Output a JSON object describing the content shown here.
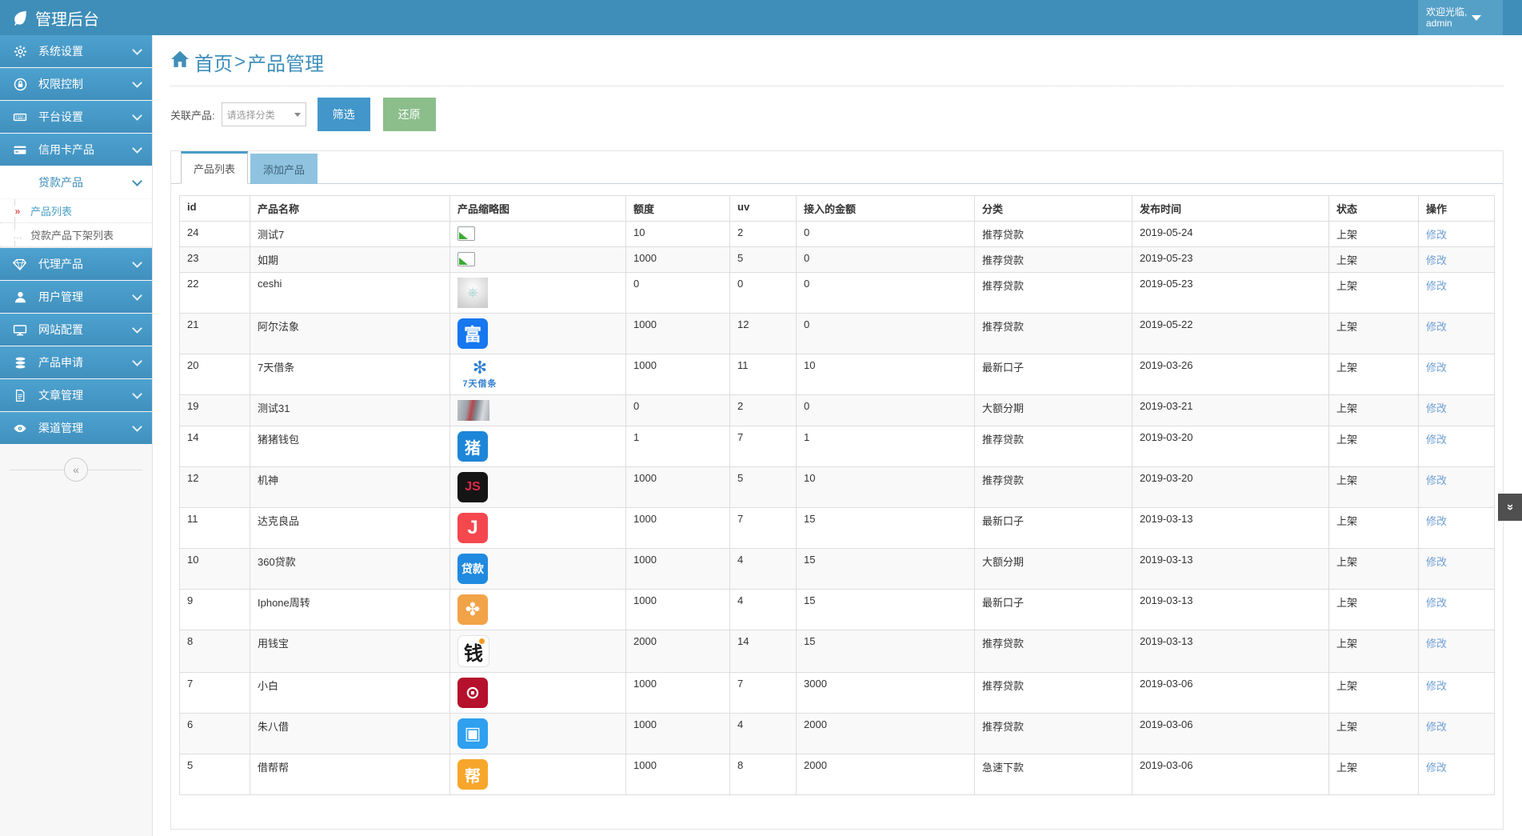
{
  "colors": {
    "accent": "#3e8eb9",
    "sidebar_item": "#4697c4",
    "filter_button": "#4296ca",
    "reset_button": "#8cbe8c",
    "link": "#6f9ed4",
    "inactive_tab": "#8fc3e0"
  },
  "header": {
    "title": "管理后台",
    "logo_icon": "leaf-icon",
    "welcome_line1": "欢迎光临,",
    "welcome_line2": "admin"
  },
  "sidebar": {
    "collapse_label": "«",
    "items": [
      {
        "label": "系统设置",
        "icon": "gear-icon"
      },
      {
        "label": "权限控制",
        "icon": "lock-icon"
      },
      {
        "label": "平台设置",
        "icon": "keyboard-icon"
      },
      {
        "label": "信用卡产品",
        "icon": "credit-card-icon"
      },
      {
        "label": "贷款产品",
        "icon": "loan-coin-icon",
        "expanded": true,
        "children": [
          {
            "label": "产品列表",
            "active": true,
            "marker": "»"
          },
          {
            "label": "贷款产品下架列表",
            "active": false,
            "marker": "…"
          }
        ]
      },
      {
        "label": "代理产品",
        "icon": "diamond-icon"
      },
      {
        "label": "用户管理",
        "icon": "user-icon"
      },
      {
        "label": "网站配置",
        "icon": "monitor-icon"
      },
      {
        "label": "产品申请",
        "icon": "database-icon"
      },
      {
        "label": "文章管理",
        "icon": "document-icon"
      },
      {
        "label": "渠道管理",
        "icon": "eye-icon"
      }
    ]
  },
  "breadcrumb": {
    "home": "首页",
    "separator": ">",
    "current": "产品管理"
  },
  "filter": {
    "label": "关联产品:",
    "select_value": "请选择分类",
    "filter_button": "筛选",
    "reset_button": "还原"
  },
  "tabs": [
    {
      "label": "产品列表",
      "active": true
    },
    {
      "label": "添加产品",
      "active": false
    }
  ],
  "table": {
    "columns": [
      "id",
      "产品名称",
      "产品缩略图",
      "额度",
      "uv",
      "接入的金额",
      "分类",
      "发布时间",
      "状态",
      "操作"
    ],
    "rows": [
      {
        "id": "24",
        "name": "测试7",
        "thumb": {
          "type": "broken",
          "name": "broken-image-icon"
        },
        "quota": "10",
        "uv": "2",
        "amount": "0",
        "category": "推荐贷款",
        "date": "2019-05-24",
        "status": "上架",
        "action": "修改"
      },
      {
        "id": "23",
        "name": "如期",
        "thumb": {
          "type": "broken",
          "name": "broken-image-icon"
        },
        "quota": "1000",
        "uv": "5",
        "amount": "0",
        "category": "推荐贷款",
        "date": "2019-05-23",
        "status": "上架",
        "action": "修改"
      },
      {
        "id": "22",
        "name": "ceshi",
        "thumb": {
          "type": "gray",
          "name": "ceshi-helm-thumbnail",
          "glyph": "⎈"
        },
        "quota": "0",
        "uv": "0",
        "amount": "0",
        "category": "推荐贷款",
        "date": "2019-05-23",
        "status": "上架",
        "action": "修改"
      },
      {
        "id": "21",
        "name": "阿尔法象",
        "thumb": {
          "type": "icon",
          "name": "alpha-elephant-app-icon",
          "bg": "#1677f0",
          "fg": "#ffffff",
          "glyph": "富",
          "size": 22
        },
        "quota": "1000",
        "uv": "12",
        "amount": "0",
        "category": "推荐贷款",
        "date": "2019-05-22",
        "status": "上架",
        "action": "修改"
      },
      {
        "id": "20",
        "name": "7天借条",
        "thumb": {
          "type": "logo",
          "name": "7tian-jietiao-logo",
          "glyph": "✻",
          "label": "7天借条"
        },
        "quota": "1000",
        "uv": "11",
        "amount": "10",
        "category": "最新口子",
        "date": "2019-03-26",
        "status": "上架",
        "action": "修改"
      },
      {
        "id": "19",
        "name": "测试31",
        "thumb": {
          "type": "photo",
          "name": "photo-thumbnail"
        },
        "quota": "0",
        "uv": "2",
        "amount": "0",
        "category": "大额分期",
        "date": "2019-03-21",
        "status": "上架",
        "action": "修改"
      },
      {
        "id": "14",
        "name": "猪猪钱包",
        "thumb": {
          "type": "icon",
          "name": "pig-wallet-app-icon",
          "bg": "#1d86d8",
          "fg": "#ffffff",
          "glyph": "猪",
          "size": 20
        },
        "quota": "1",
        "uv": "7",
        "amount": "1",
        "category": "推荐贷款",
        "date": "2019-03-20",
        "status": "上架",
        "action": "修改"
      },
      {
        "id": "12",
        "name": "机神",
        "thumb": {
          "type": "icon",
          "name": "jishen-app-icon",
          "bg": "#151515",
          "fg": "#e2284a",
          "glyph": "JS",
          "size": 16
        },
        "quota": "1000",
        "uv": "5",
        "amount": "10",
        "category": "推荐贷款",
        "date": "2019-03-20",
        "status": "上架",
        "action": "修改"
      },
      {
        "id": "11",
        "name": "达克良品",
        "thumb": {
          "type": "icon",
          "name": "dake-app-icon",
          "bg": "#f4484e",
          "fg": "#ffffff",
          "glyph": "J",
          "size": 24
        },
        "quota": "1000",
        "uv": "7",
        "amount": "15",
        "category": "最新口子",
        "date": "2019-03-13",
        "status": "上架",
        "action": "修改"
      },
      {
        "id": "10",
        "name": "360贷款",
        "thumb": {
          "type": "icon",
          "name": "360-loan-app-icon",
          "bg": "#1f8ae0",
          "fg": "#ffffff",
          "glyph": "贷款",
          "size": 14
        },
        "quota": "1000",
        "uv": "4",
        "amount": "15",
        "category": "大额分期",
        "date": "2019-03-13",
        "status": "上架",
        "action": "修改"
      },
      {
        "id": "9",
        "name": "Iphone周转",
        "thumb": {
          "type": "icon",
          "name": "iphone-turnover-app-icon",
          "bg": "#f2a348",
          "fg": "#ffffff",
          "glyph": "✤",
          "size": 22
        },
        "quota": "1000",
        "uv": "4",
        "amount": "15",
        "category": "最新口子",
        "date": "2019-03-13",
        "status": "上架",
        "action": "修改"
      },
      {
        "id": "8",
        "name": "用钱宝",
        "thumb": {
          "type": "icon",
          "name": "yongqianbao-app-icon",
          "bg": "#ffffff",
          "fg": "#1a1a1a",
          "glyph": "钱",
          "size": 24,
          "border": "#e0e0e0",
          "dot": "#f59a23"
        },
        "quota": "2000",
        "uv": "14",
        "amount": "15",
        "category": "推荐贷款",
        "date": "2019-03-13",
        "status": "上架",
        "action": "修改"
      },
      {
        "id": "7",
        "name": "小白",
        "thumb": {
          "type": "icon",
          "name": "xiaobai-app-icon",
          "bg": "#b5102c",
          "fg": "#ffffff",
          "glyph": "⊙",
          "size": 22
        },
        "quota": "1000",
        "uv": "7",
        "amount": "3000",
        "category": "推荐贷款",
        "date": "2019-03-06",
        "status": "上架",
        "action": "修改"
      },
      {
        "id": "6",
        "name": "朱八借",
        "thumb": {
          "type": "icon",
          "name": "zhubajie-app-icon",
          "bg": "#2ea0ef",
          "fg": "#ffffff",
          "glyph": "▣",
          "size": 22
        },
        "quota": "1000",
        "uv": "4",
        "amount": "2000",
        "category": "推荐贷款",
        "date": "2019-03-06",
        "status": "上架",
        "action": "修改"
      },
      {
        "id": "5",
        "name": "借帮帮",
        "thumb": {
          "type": "icon",
          "name": "jiebangbang-app-icon",
          "bg": "#f7a62c",
          "fg": "#ffffff",
          "glyph": "帮",
          "size": 20
        },
        "quota": "1000",
        "uv": "8",
        "amount": "2000",
        "category": "急速下款",
        "date": "2019-03-06",
        "status": "上架",
        "action": "修改"
      }
    ]
  },
  "back_to_top": {
    "glyph": "«"
  }
}
